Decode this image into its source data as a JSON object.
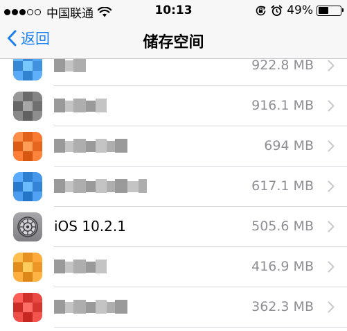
{
  "status_bar": {
    "carrier": "中国联通",
    "time": "10:13",
    "battery_percent": "49%",
    "battery_level": 0.49,
    "signal_dots": 3,
    "icons": [
      "wifi-icon",
      "rotation-lock-icon",
      "alarm-clock-icon",
      "battery-icon"
    ]
  },
  "nav": {
    "back_label": "返回",
    "title": "储存空间"
  },
  "colors": {
    "accent": "#1a7ff0",
    "secondary_text": "#8e8e93",
    "separator": "#d8d8dc",
    "nav_bg": "#f7f7f7"
  },
  "apps": [
    {
      "name": "",
      "size": "922.8 MB",
      "icon": "blurred-app-icon",
      "icon_color": "#4a9be8"
    },
    {
      "name": "",
      "size": "916.1 MB",
      "icon": "blurred-app-icon",
      "icon_color": "#7a7a7a"
    },
    {
      "name": "",
      "size": "694 MB",
      "icon": "blurred-app-icon",
      "icon_color": "#f0702a"
    },
    {
      "name": "",
      "size": "617.1 MB",
      "icon": "blurred-app-icon",
      "icon_color": "#3d8de0"
    },
    {
      "name": "iOS 10.2.1",
      "size": "505.6 MB",
      "icon": "settings-gear-icon",
      "icon_color": "#8e8e93"
    },
    {
      "name": "",
      "size": "416.9 MB",
      "icon": "blurred-app-icon",
      "icon_color": "#f5a030"
    },
    {
      "name": "",
      "size": "362.3 MB",
      "icon": "blurred-app-icon",
      "icon_color": "#e0403a"
    }
  ]
}
